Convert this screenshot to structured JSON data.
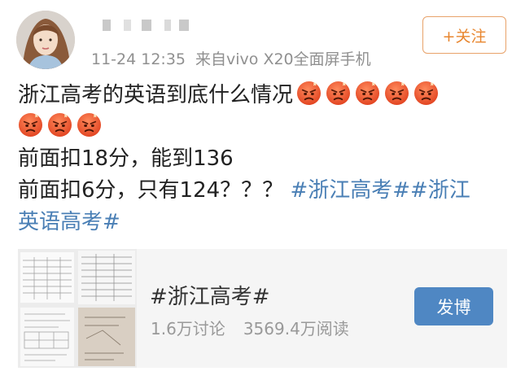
{
  "post": {
    "author": {
      "name_obscured": true
    },
    "time": "11-24 12:35",
    "source": "来自vivo X20全面屏手机",
    "follow_label": "+关注",
    "lines": [
      {
        "text": "浙江高考的英语到底什么情况",
        "emoji_count": 5
      },
      {
        "text": "",
        "emoji_count": 3
      },
      {
        "text": "前面扣18分，能到136"
      },
      {
        "text": "前面扣6分，只有124？？？",
        "topic": "#浙江高考##浙江"
      },
      {
        "topic": "英语高考#"
      }
    ],
    "emoji_name": "angry-face-emoji"
  },
  "topic_card": {
    "title": "#浙江高考#",
    "discussions": "1.6万讨论",
    "reads": "3569.4万阅读",
    "action_label": "发博"
  },
  "colors": {
    "topic_link": "#4a7fb5",
    "follow_border": "#e8a26a",
    "follow_text": "#e8862f",
    "button_blue": "#4f87c3",
    "meta_gray": "#909090",
    "card_bg": "#f5f5f5"
  }
}
